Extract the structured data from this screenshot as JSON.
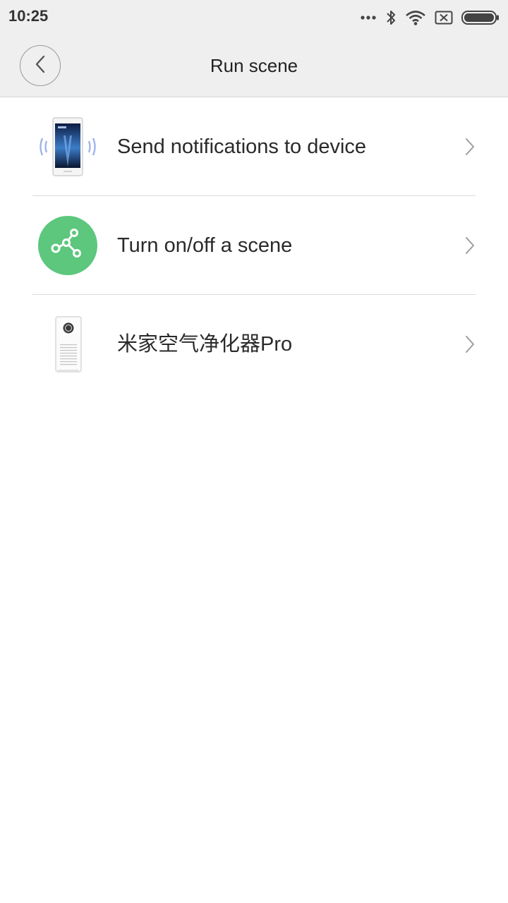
{
  "status_bar": {
    "time": "10:25",
    "icons": [
      "more-dots-icon",
      "bluetooth-icon",
      "wifi-icon",
      "no-sim-icon",
      "battery-icon"
    ]
  },
  "header": {
    "title": "Run scene",
    "back_icon": "chevron-left-icon"
  },
  "items": [
    {
      "label": "Send notifications to device",
      "icon": "phone-notification-icon"
    },
    {
      "label": "Turn on/off a scene",
      "icon": "scene-icon",
      "icon_color": "#5cc77d"
    },
    {
      "label": "米家空气净化器Pro",
      "icon": "air-purifier-icon"
    }
  ],
  "colors": {
    "bar_background": "#efefef",
    "scene_accent": "#5cc77d",
    "vibration_accent": "#9fb4ec"
  }
}
